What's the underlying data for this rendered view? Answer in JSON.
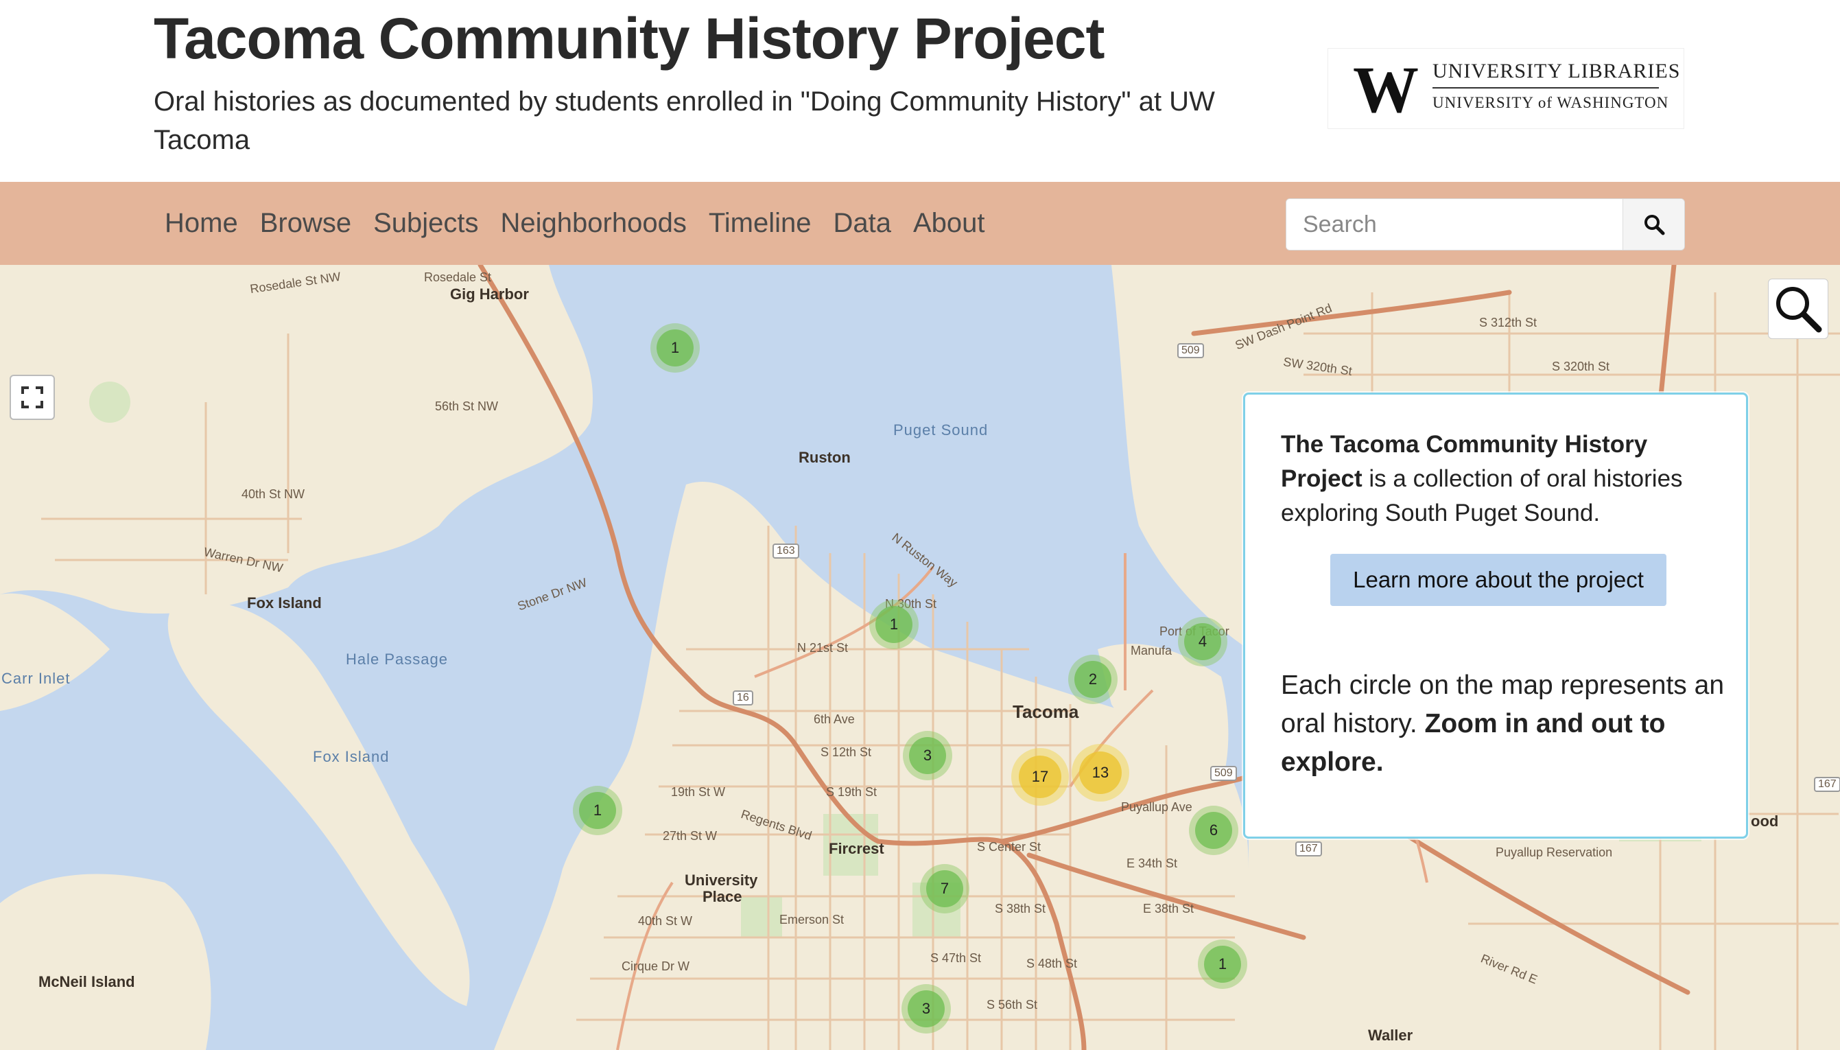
{
  "header": {
    "title": "Tacoma Community History Project",
    "subtitle": "Oral histories as documented by students enrolled in \"Doing Community History\" at UW Tacoma",
    "logo": {
      "mark": "W",
      "line1": "UNIVERSITY LIBRARIES",
      "line2": "UNIVERSITY of WASHINGTON"
    }
  },
  "nav": {
    "items": [
      "Home",
      "Browse",
      "Subjects",
      "Neighborhoods",
      "Timeline",
      "Data",
      "About"
    ],
    "search_placeholder": "Search",
    "search_icon": "search-icon"
  },
  "colors": {
    "navbar": "#e4b59a",
    "water": "#c4d7ee",
    "land": "#f2ebd9",
    "cluster_green": "#6ebe50",
    "cluster_yellow": "#ecc432",
    "button": "#b9d2ee",
    "panel_border": "#7fd0e8"
  },
  "map": {
    "labels": {
      "gig_harbor": "Gig Harbor",
      "ruston": "Ruston",
      "puget_sound": "Puget Sound",
      "fox_island_1": "Fox Island",
      "fox_island_2": "Fox Island",
      "hale_passage": "Hale Passage",
      "carr_inlet": "Carr Inlet",
      "mcneil_island": "McNeil Island",
      "fircrest": "Fircrest",
      "university_place_1": "University",
      "university_place_2": "Place",
      "tacoma": "Tacoma",
      "waller": "Waller",
      "puyallup_reservation": "Puyallup Reservation",
      "rosedale_st_nw": "Rosedale St NW",
      "rosedale_st": "Rosedale St",
      "56th_st_nw": "56th St NW",
      "40th_st_nw": "40th St NW",
      "warren_dr_nw": "Warren Dr NW",
      "stone_dr_nw": "Stone Dr NW",
      "n_ruston_way": "N Ruston Way",
      "n_21st_st": "N 21st St",
      "n_30th_st": "N 30th St",
      "6th_ave": "6th Ave",
      "s_12th_st": "S 12th St",
      "s_19th_st": "S 19th St",
      "19th_st_w": "19th St W",
      "27th_st_w": "27th St W",
      "40th_st_w": "40th St W",
      "s_center_st": "S Center St",
      "s_38th_st": "S 38th St",
      "s_47th_st": "S 47th St",
      "s_48th_st": "S 48th St",
      "s_56th_st": "S 56th St",
      "e_34th_st": "E 34th St",
      "e_38th_st": "E 38th St",
      "puyallup_ave": "Puyallup Ave",
      "sw_dash_point_rd": "SW Dash Point Rd",
      "s_312th_st": "S 312th St",
      "s_320th_st": "S 320th St",
      "sw_320th_st": "SW 320th St",
      "river_rd_e": "River Rd E",
      "emerson_st": "Emerson St",
      "cirque_dr_w": "Cirque Dr W",
      "regents_blvd": "Regents Blvd",
      "port_of_tacoma": "Port of Tacor",
      "manufacturing": "Manufa",
      "ood": "ood",
      "route_163": "163",
      "route_16": "16",
      "route_509a": "509",
      "route_509b": "509",
      "route_167a": "167",
      "route_167b": "167"
    },
    "clusters": [
      {
        "count": "1",
        "kind": "green"
      },
      {
        "count": "1",
        "kind": "green"
      },
      {
        "count": "4",
        "kind": "green"
      },
      {
        "count": "2",
        "kind": "green"
      },
      {
        "count": "3",
        "kind": "green"
      },
      {
        "count": "17",
        "kind": "yellow"
      },
      {
        "count": "13",
        "kind": "yellow"
      },
      {
        "count": "1",
        "kind": "green"
      },
      {
        "count": "6",
        "kind": "green"
      },
      {
        "count": "7",
        "kind": "green"
      },
      {
        "count": "1",
        "kind": "green"
      },
      {
        "count": "3",
        "kind": "green"
      }
    ],
    "fullscreen_icon": "fullscreen-icon",
    "zoom_search_icon": "magnifier-icon"
  },
  "info_panel": {
    "intro_bold": "The Tacoma Community History Project",
    "intro_rest": " is a collection of oral histories exploring South Puget Sound.",
    "button_label": "Learn more about the project",
    "explain_plain": "Each circle on the map represents an oral history. ",
    "explain_bold": "Zoom in and out to explore."
  }
}
